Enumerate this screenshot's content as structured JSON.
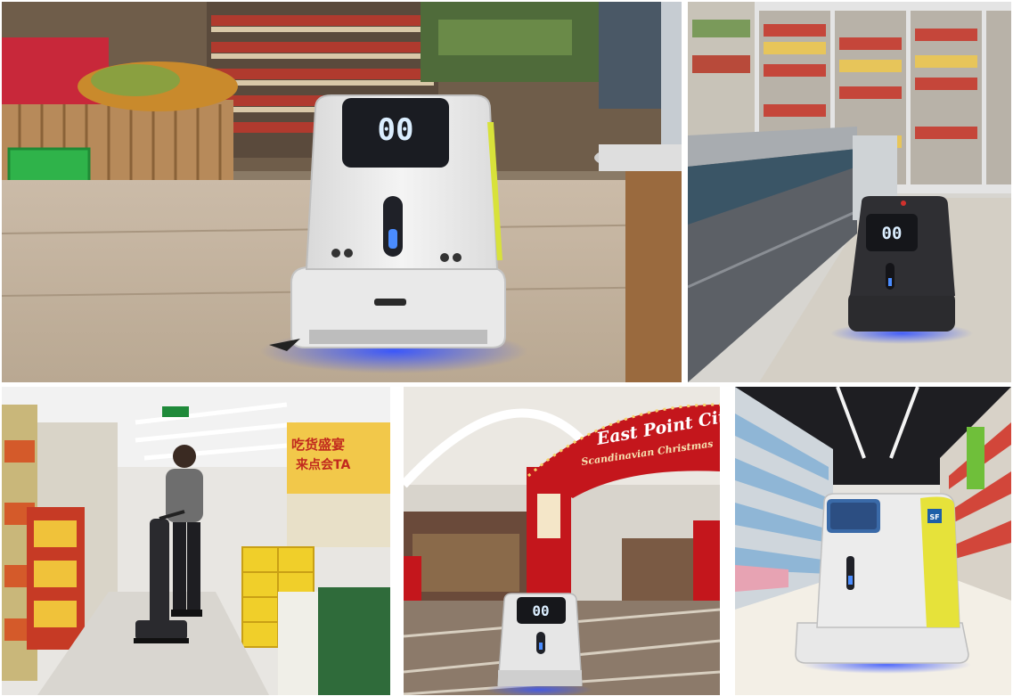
{
  "collage": {
    "panels": [
      {
        "id": "p1",
        "subject": "white-robot-grocery-aisle",
        "robot_face": "00"
      },
      {
        "id": "p2",
        "subject": "dark-robot-freezer-aisle",
        "robot_face": "00"
      },
      {
        "id": "p3",
        "subject": "worker-floor-scrubber",
        "sign_text": "吃货盛宴",
        "sign_text_2": "来点会TA"
      },
      {
        "id": "p4",
        "subject": "robot-mall-christmas-arch",
        "robot_face": "00",
        "arch_title": "East Point City",
        "arch_subtitle": "Scandinavian Christmas"
      },
      {
        "id": "p5",
        "subject": "robot-drink-aisle",
        "robot_badge": "SF"
      }
    ]
  },
  "colors": {
    "robot_white": "#eeeeee",
    "robot_dark": "#2b2b2e",
    "robot_screen": "#1a1c22",
    "eye_glow": "#dbeeff",
    "accent_yellow": "#d8e23a",
    "floor_glow": "#2f4dff",
    "arch_red": "#c4161c"
  }
}
